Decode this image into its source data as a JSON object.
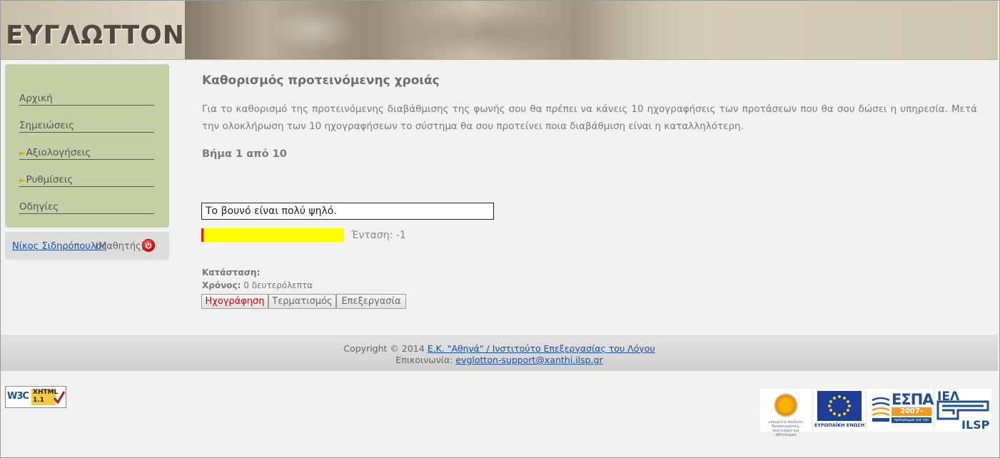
{
  "header": {
    "logo_text": "ΕΥΓΛΩΤΤΟΝ"
  },
  "sidebar": {
    "items": [
      {
        "label": "Αρχική",
        "has_arrow": false
      },
      {
        "label": "Σημειώσεις",
        "has_arrow": false
      },
      {
        "label": "Αξιολογήσεις",
        "has_arrow": true
      },
      {
        "label": "Ρυθμίσεις",
        "has_arrow": true
      },
      {
        "label": "Οδηγίες",
        "has_arrow": false
      }
    ],
    "arrow_glyph": "►",
    "user": {
      "name": "Νίκος Σιδηρόπουλος",
      "role": "(Μαθητής)",
      "logout_icon": "power-icon"
    }
  },
  "main": {
    "title": "Καθορισμός προτεινόμενης χροιάς",
    "intro": "Για το καθορισμό της προτεινόμενης διαβάθμισης της φωνής σου θα πρέπει να κάνεις 10 ηχογραφήσεις των προτάσεων που θα σου δώσει η υπηρεσία. Μετά την ολοκλήρωση των 10 ηχογραφήσεων το σύστημα θα σου προτείνει ποια διαβάθμιση είναι η καταλληλότερη.",
    "step": "Βήμα 1 από 10",
    "sentence": "Το βουνό είναι πολύ ψηλό.",
    "intensity_label": "Ένταση: -1",
    "meter": {
      "level_fraction": 0.015,
      "bar_color": "#ffff00",
      "level_color": "#e02020"
    },
    "status_label": "Κατάσταση:",
    "time_label": "Χρόνος:",
    "time_value": "0 δευτερόλεπτα",
    "buttons": {
      "record": "Ηχογράφηση",
      "stop": "Τερματισμός",
      "edit": "Επεξεργασία"
    }
  },
  "footer": {
    "copyright_prefix": "Copyright © 2014",
    "copyright_link": "Ε.Κ. \"Αθηνά\" / Ινστιτούτο Επεξεργασίας του Λόγου",
    "contact_prefix": "Επικοινωνία:",
    "contact_email": "evglotton-support@xanthi.ilsp.gr"
  },
  "badges": {
    "w3c_text": "W3C",
    "xhtml_line1": "XHTML",
    "xhtml_line2": "1.1",
    "eu_label": "ΕΥΡΩΠΑΪΚΗ ΕΝΩΣΗ",
    "espa_title": "ΕΣΠΑ",
    "espa_years": "2007-2013",
    "espa_sub": "πρόγραμμα για την ανάπτυξη",
    "ilsp_top": "ΙΕΛ",
    "ilsp_bottom": "ILSP",
    "ministry_label": "υπουργείο παιδείας θρησκευμάτων, πολιτισμού και αθλητισμού"
  },
  "colors": {
    "nav_bg": "#c3cfa4",
    "link": "#1f4fa0",
    "record_text": "#d40000"
  }
}
